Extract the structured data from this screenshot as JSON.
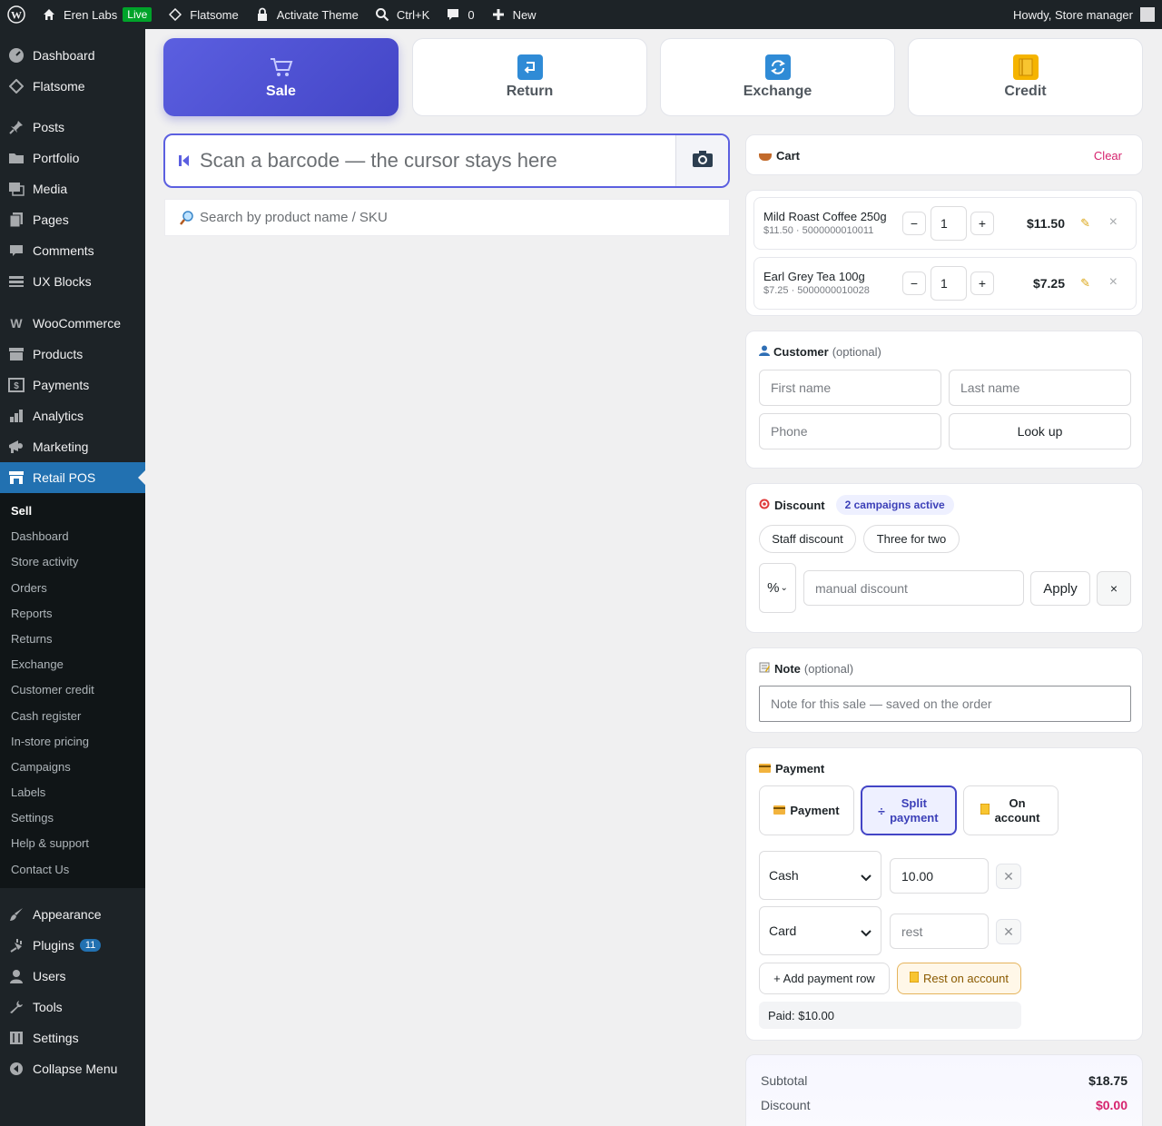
{
  "adminbar": {
    "site": "Eren Labs",
    "live": "Live",
    "theme": "Flatsome",
    "activate": "Activate Theme",
    "shortcut": "Ctrl+K",
    "comments": "0",
    "new": "New",
    "howdy": "Howdy, Store manager"
  },
  "sidebar": {
    "top": [
      "Dashboard",
      "Flatsome"
    ],
    "group2": [
      "Posts",
      "Portfolio",
      "Media",
      "Pages",
      "Comments",
      "UX Blocks"
    ],
    "group3": [
      "WooCommerce",
      "Products",
      "Payments",
      "Analytics",
      "Marketing"
    ],
    "active": "Retail POS",
    "submenu": [
      "Sell",
      "Dashboard",
      "Store activity",
      "Orders",
      "Reports",
      "Returns",
      "Exchange",
      "Customer credit",
      "Cash register",
      "In-store pricing",
      "Campaigns",
      "Labels",
      "Settings",
      "Help & support",
      "Contact Us"
    ],
    "bottom": [
      "Appearance",
      "Plugins",
      "Users",
      "Tools",
      "Settings",
      "Collapse Menu"
    ],
    "plugins_count": "11"
  },
  "modes": [
    "Sale",
    "Return",
    "Exchange",
    "Credit"
  ],
  "scan": {
    "placeholder": "Scan a barcode — the cursor stays here"
  },
  "search": {
    "placeholder": "Search by product name / SKU"
  },
  "cart": {
    "title": "Cart",
    "clear": "Clear",
    "items": [
      {
        "name": "Mild Roast Coffee 250g",
        "meta": "$11.50 · 5000000010011",
        "qty": "1",
        "price": "$11.50"
      },
      {
        "name": "Earl Grey Tea 100g",
        "meta": "$7.25 · 5000000010028",
        "qty": "1",
        "price": "$7.25"
      }
    ],
    "minus": "−",
    "plus": "+"
  },
  "customer": {
    "title": "Customer",
    "optional": "(optional)",
    "first": "First name",
    "last": "Last name",
    "phone": "Phone",
    "lookup": "Look up"
  },
  "discount": {
    "title": "Discount",
    "campaigns": "2 campaigns active",
    "pills": [
      "Staff discount",
      "Three for two"
    ],
    "type": "%",
    "placeholder": "manual discount",
    "apply": "Apply",
    "clear": "×"
  },
  "note": {
    "title": "Note",
    "optional": "(optional)",
    "placeholder": "Note for this sale — saved on the order"
  },
  "payment": {
    "title": "Payment",
    "methods": [
      "Payment",
      "Split payment",
      "On account"
    ],
    "rows": [
      {
        "method": "Cash",
        "amount": "10.00",
        "placeholder": ""
      },
      {
        "method": "Card",
        "amount": "",
        "placeholder": "rest"
      }
    ],
    "add_row": "+ Add payment row",
    "rest": "Rest on account",
    "paid": "Paid: $10.00"
  },
  "totals": {
    "subtotal_label": "Subtotal",
    "subtotal": "$18.75",
    "discount_label": "Discount",
    "discount": "$0.00"
  },
  "colors": {
    "accent": "#4345c6",
    "wp_blue": "#2271b1",
    "pink": "#d6246e"
  }
}
